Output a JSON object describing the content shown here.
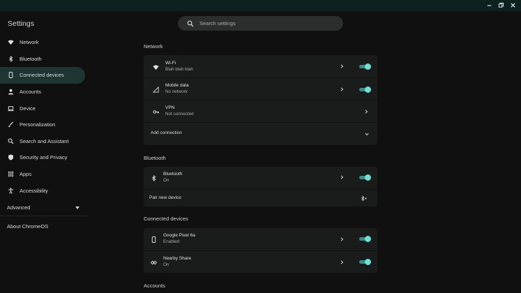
{
  "app": {
    "title": "Settings"
  },
  "search": {
    "placeholder": "Search settings"
  },
  "sidebar": {
    "items": [
      {
        "label": "Network"
      },
      {
        "label": "Bluetooth"
      },
      {
        "label": "Connected devices"
      },
      {
        "label": "Accounts"
      },
      {
        "label": "Device"
      },
      {
        "label": "Personalization"
      },
      {
        "label": "Search and Assistant"
      },
      {
        "label": "Security and Privacy"
      },
      {
        "label": "Apps"
      },
      {
        "label": "Accessibility"
      }
    ],
    "advanced_label": "Advanced",
    "about_label": "About ChromeOS"
  },
  "sections": {
    "network": {
      "title": "Network",
      "wifi": {
        "title": "Wi-Fi",
        "subtitle": "Blah blah blah"
      },
      "mobile": {
        "title": "Mobile data",
        "subtitle": "No network"
      },
      "vpn": {
        "title": "VPN",
        "subtitle": "Not connected"
      },
      "add_connection": "Add connection"
    },
    "bluetooth": {
      "title": "Bluetooth",
      "bluetooth": {
        "title": "Bluetooth",
        "subtitle": "On"
      },
      "pair": "Pair new device"
    },
    "connected": {
      "title": "Connected devices",
      "pixel": {
        "title": "Google Pixel 6a",
        "subtitle": "Enabled"
      },
      "nearby": {
        "title": "Nearby Share",
        "subtitle": "On"
      }
    },
    "accounts": {
      "title": "Accounts"
    }
  },
  "colors": {
    "accent": "#6fe0d3",
    "active_nav": "#1d3533",
    "card": "#1a1c1b",
    "titlebar": "#0c2120"
  }
}
